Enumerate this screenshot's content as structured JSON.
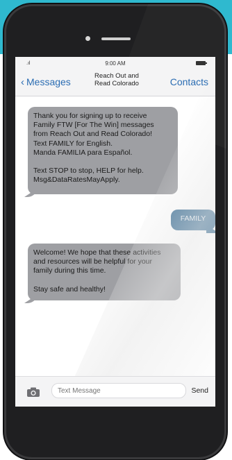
{
  "status_bar": {
    "signal": ".ıl",
    "time": "9:00 AM"
  },
  "nav": {
    "back_label": "Messages",
    "back_chevron": "‹",
    "title_line1": "Reach Out and",
    "title_line2": "Read Colorado",
    "contacts_label": "Contacts"
  },
  "messages": [
    {
      "direction": "incoming",
      "text": "Thank you for signing up to receive\nFamily FTW [For The Win] messages\nfrom Reach Out and Read Colorado!\nText FAMILY for English.\nManda FAMILIA para Español.\n\nText STOP to stop, HELP for help.\nMsg&DataRatesMayApply."
    },
    {
      "direction": "outgoing",
      "text": "FAMILY"
    },
    {
      "direction": "incoming",
      "text": "Welcome! We hope that these activities\nand resources will be helpful for your\nfamily during this time.\n\nStay safe and healthy!"
    }
  ],
  "compose": {
    "placeholder": "Text Message",
    "send_label": "Send",
    "camera_icon": "camera-icon"
  },
  "colors": {
    "background_accent": "#2fb9cf",
    "incoming_bubble": "#9e9fa3",
    "outgoing_bubble": "#3f7196",
    "link": "#2b6db3",
    "phone_body": "#1f1f21"
  }
}
